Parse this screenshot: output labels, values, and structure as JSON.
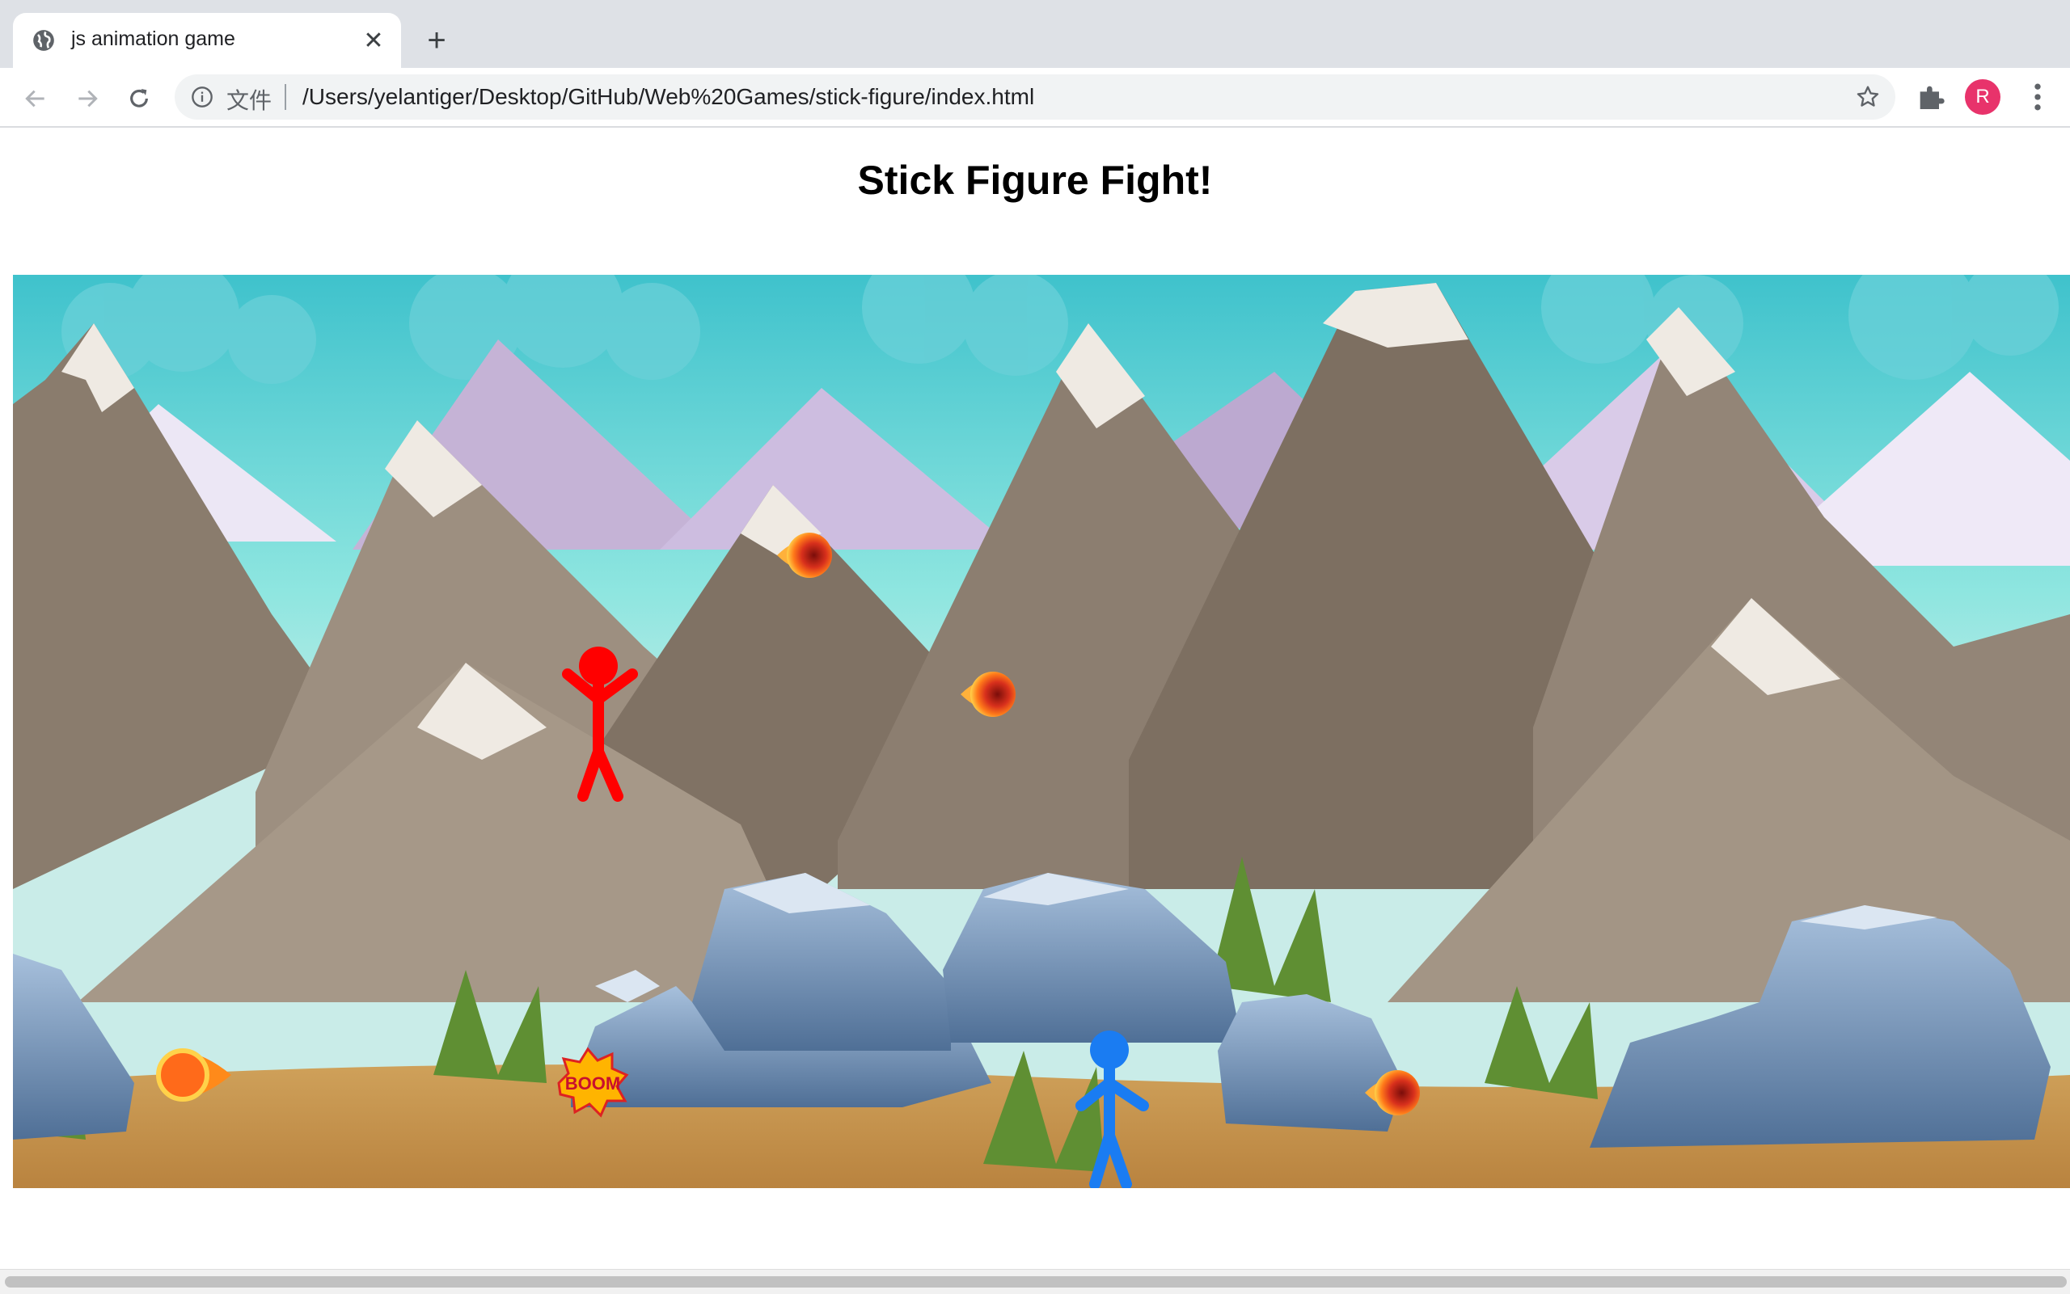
{
  "tab": {
    "title": "js animation game",
    "close_glyph": "✕",
    "favicon": "globe-icon"
  },
  "new_tab_glyph": "+",
  "toolbar": {
    "scheme_label": "文件",
    "url": "/Users/yelantiger/Desktop/GitHub/Web%20Games/stick-figure/index.html",
    "profile_initial": "R",
    "profile_color": "#e8336b"
  },
  "page": {
    "title": "Stick Figure Fight!"
  },
  "game": {
    "sky_color": "#3fc2cc",
    "player_red_color": "#ff0000",
    "player_blue_color": "#1a7cf2",
    "boom_text": "BOOM"
  }
}
